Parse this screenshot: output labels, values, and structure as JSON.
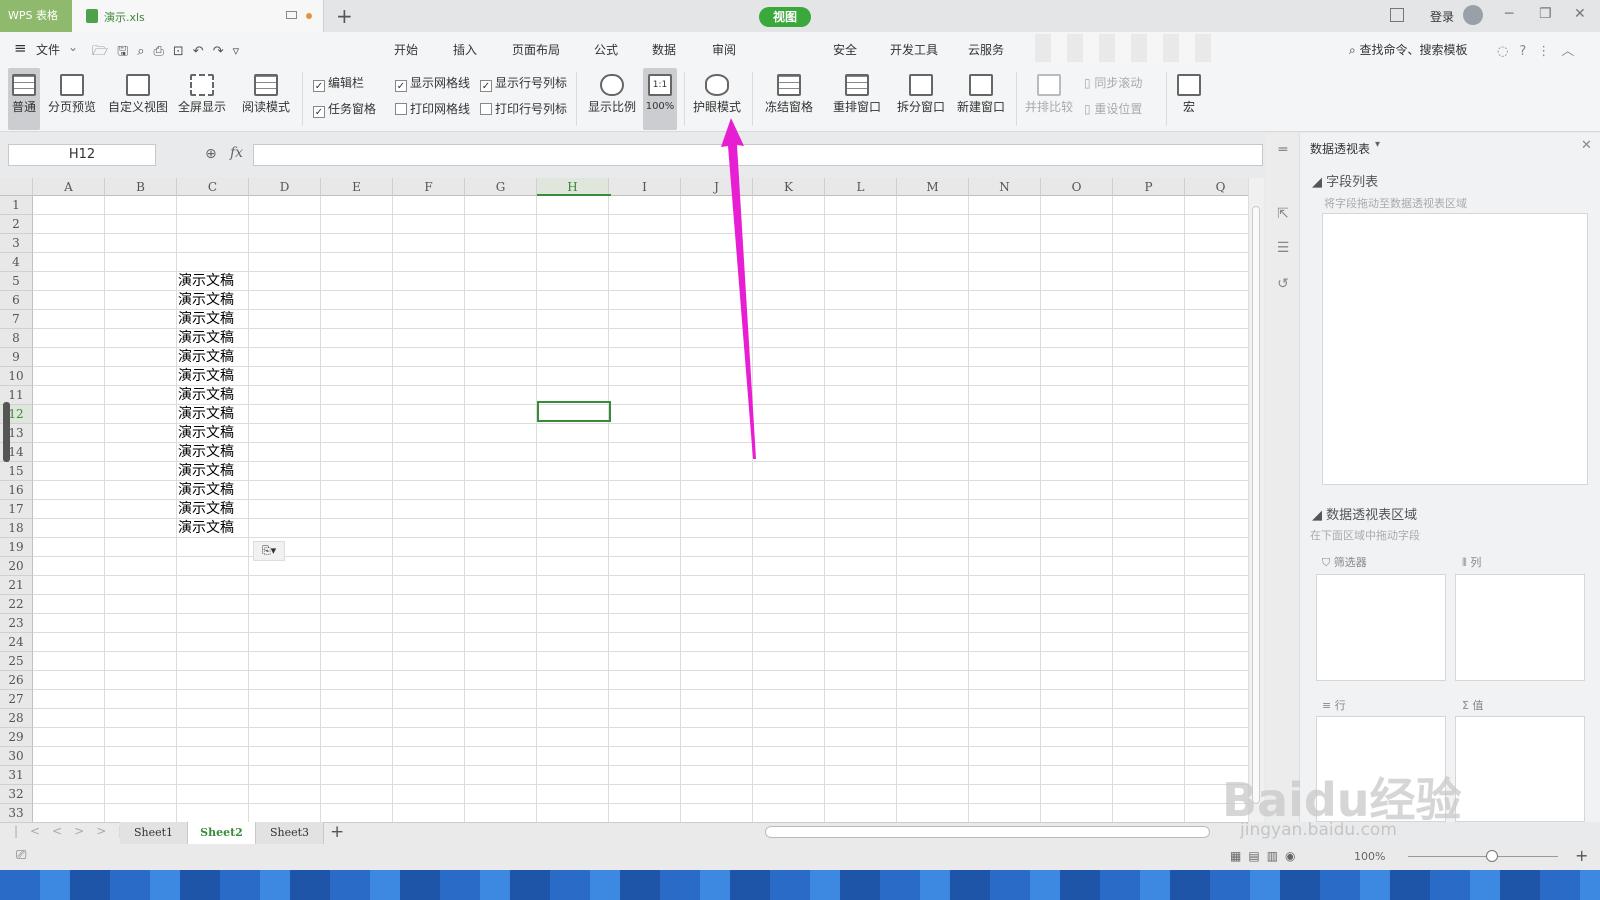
{
  "titlebar": {
    "app_label": "WPS 表格",
    "doc_name": "演示.xls",
    "new_tab": "+",
    "login": "登录"
  },
  "menu": {
    "hamburger": "≡",
    "file": "文件",
    "tabs": [
      "开始",
      "插入",
      "页面布局",
      "公式",
      "数据",
      "审阅",
      "视图",
      "安全",
      "开发工具",
      "云服务"
    ],
    "active_tab": "视图",
    "search_placeholder": "查找命令、搜索模板"
  },
  "ribbon": {
    "normal": "普通",
    "page_preview": "分页预览",
    "custom_view": "自定义视图",
    "fullscreen": "全屏显示",
    "reading_mode": "阅读模式",
    "edit_bar": "编辑栏",
    "task_pane": "任务窗格",
    "show_gridlines": "显示网格线",
    "print_gridlines": "打印网格线",
    "show_headings": "显示行号列标",
    "print_headings": "打印行号列标",
    "zoom_ratio": "显示比例",
    "zoom_100": "100%",
    "eye_mode": "护眼模式",
    "freeze_panes": "冻结窗格",
    "arrange": "重排窗口",
    "split": "拆分窗口",
    "new_window": "新建窗口",
    "side_by_side": "并排比较",
    "sync_scroll": "同步滚动",
    "reset_pos": "重设位置",
    "macro": "宏"
  },
  "formula_bar": {
    "name_box": "H12",
    "fx": "fx",
    "value": ""
  },
  "grid": {
    "columns": [
      "A",
      "B",
      "C",
      "D",
      "E",
      "F",
      "G",
      "H",
      "I",
      "J",
      "K",
      "L",
      "M",
      "N",
      "O",
      "P",
      "Q"
    ],
    "rows": [
      "1",
      "2",
      "3",
      "4",
      "5",
      "6",
      "7",
      "8",
      "9",
      "10",
      "11",
      "12",
      "13",
      "14",
      "15",
      "16",
      "17",
      "18",
      "19",
      "20",
      "21",
      "22",
      "23",
      "24",
      "25",
      "26",
      "27",
      "28",
      "29",
      "30",
      "31",
      "32",
      "33"
    ],
    "c_values": [
      "演示文稿",
      "演示文稿",
      "演示文稿",
      "演示文稿",
      "演示文稿",
      "演示文稿",
      "演示文稿",
      "演示文稿",
      "演示文稿",
      "演示文稿",
      "演示文稿",
      "演示文稿",
      "演示文稿",
      "演示文稿"
    ],
    "selected_cell": "H12"
  },
  "pivot_panel": {
    "title": "数据透视表",
    "field_list": "字段列表",
    "field_hint": "将字段拖动至数据透视表区域",
    "area": "数据透视表区域",
    "area_hint": "在下面区域中拖动字段",
    "filter": "筛选器",
    "column": "列",
    "row": "行",
    "value": "值"
  },
  "sheets": {
    "tabs": [
      "Sheet1",
      "Sheet2",
      "Sheet3"
    ],
    "active": "Sheet2",
    "add": "+"
  },
  "status": {
    "zoom": "100%"
  },
  "watermark": {
    "brand": "Baidu经验",
    "url": "jingyan.baidu.com"
  },
  "colors": {
    "accent": "#3aa83a",
    "arrow": "#e81ed3"
  }
}
